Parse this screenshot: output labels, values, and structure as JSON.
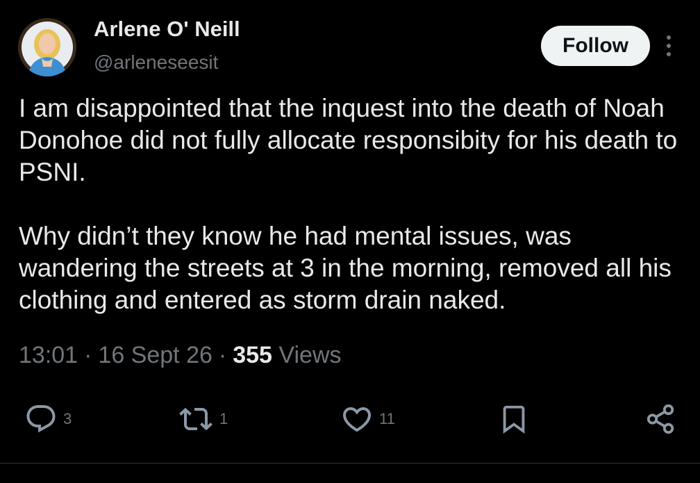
{
  "author": {
    "name": "Arlene O' Neill",
    "handle": "@arleneseesit"
  },
  "follow_label": "Follow",
  "tweet": {
    "paragraphs": [
      "I am disappointed that the inquest into the death of Noah Donohoe did not fully allocate responsibity for his death to PSNI.",
      "Why didn’t they know he had mental issues, was wandering the streets at 3 in the morning, removed all his clothing and entered as storm drain naked."
    ]
  },
  "meta": {
    "time": "13:01",
    "date": "16 Sept 26",
    "separator": "·",
    "views_count": "355",
    "views_label": "Views"
  },
  "actions": {
    "replies": "3",
    "reposts": "1",
    "likes": "11"
  },
  "icons": {
    "reply": "reply-icon",
    "repost": "repost-icon",
    "like": "heart-icon",
    "bookmark": "bookmark-icon",
    "share": "share-icon",
    "more": "more-icon"
  },
  "colors": {
    "background": "#000000",
    "text_primary": "#e7e9ea",
    "text_secondary": "#71767b",
    "button_bg": "#eff3f4",
    "button_text": "#0f1419",
    "divider": "#2f3336"
  }
}
